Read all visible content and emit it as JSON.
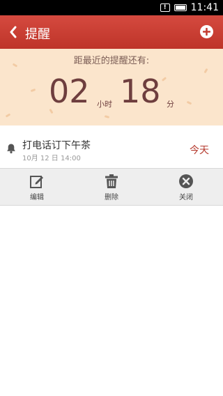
{
  "statusbar": {
    "time": "11:41",
    "notif_glyph": "!"
  },
  "appbar": {
    "title": "提醒",
    "back_icon": "chevron-left-icon",
    "add_icon": "plus-icon"
  },
  "countdown": {
    "label": "距最近的提醒还有:",
    "hours": "02",
    "hours_unit": "小时",
    "minutes": "18",
    "minutes_unit": "分"
  },
  "reminder": {
    "title": "打电话订下午茶",
    "datetime": "10月 12 日 14:00",
    "day": "今天",
    "icon": "bell-icon"
  },
  "actions": [
    {
      "label": "编辑",
      "icon": "edit-icon"
    },
    {
      "label": "删除",
      "icon": "trash-icon"
    },
    {
      "label": "关闭",
      "icon": "close-circle-icon"
    }
  ],
  "colors": {
    "appbar": "#c93b30",
    "countdown_bg": "#fbe5cc",
    "number": "#6e3e3e",
    "accent": "#b53a2e"
  }
}
